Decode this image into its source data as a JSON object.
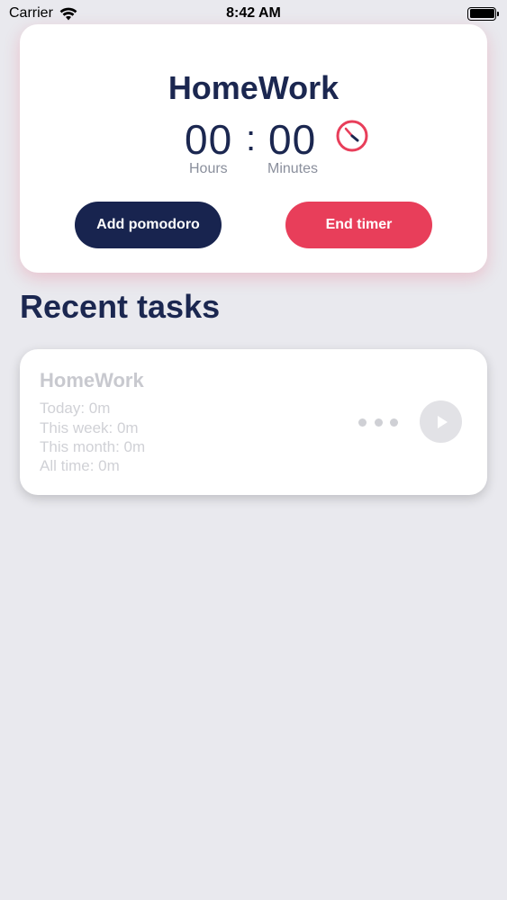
{
  "status_bar": {
    "carrier": "Carrier",
    "time": "8:42 AM",
    "icons": [
      "wifi-icon",
      "battery-icon"
    ]
  },
  "timer": {
    "task_name": "HomeWork",
    "hours": "00",
    "separator": ":",
    "minutes": "00",
    "hours_label": "Hours",
    "minutes_label": "Minutes",
    "gauge_icon": "gauge-icon",
    "add_pomodoro_label": "Add pomodoro",
    "end_timer_label": "End timer"
  },
  "recent": {
    "title": "Recent tasks",
    "tasks": [
      {
        "name": "HomeWork",
        "today": "Today: 0m",
        "week": "This week: 0m",
        "month": "This month: 0m",
        "all_time": "All time: 0m"
      }
    ]
  },
  "colors": {
    "primary_navy": "#18244f",
    "accent_red": "#e83e5a",
    "background": "#e9e9ee"
  }
}
